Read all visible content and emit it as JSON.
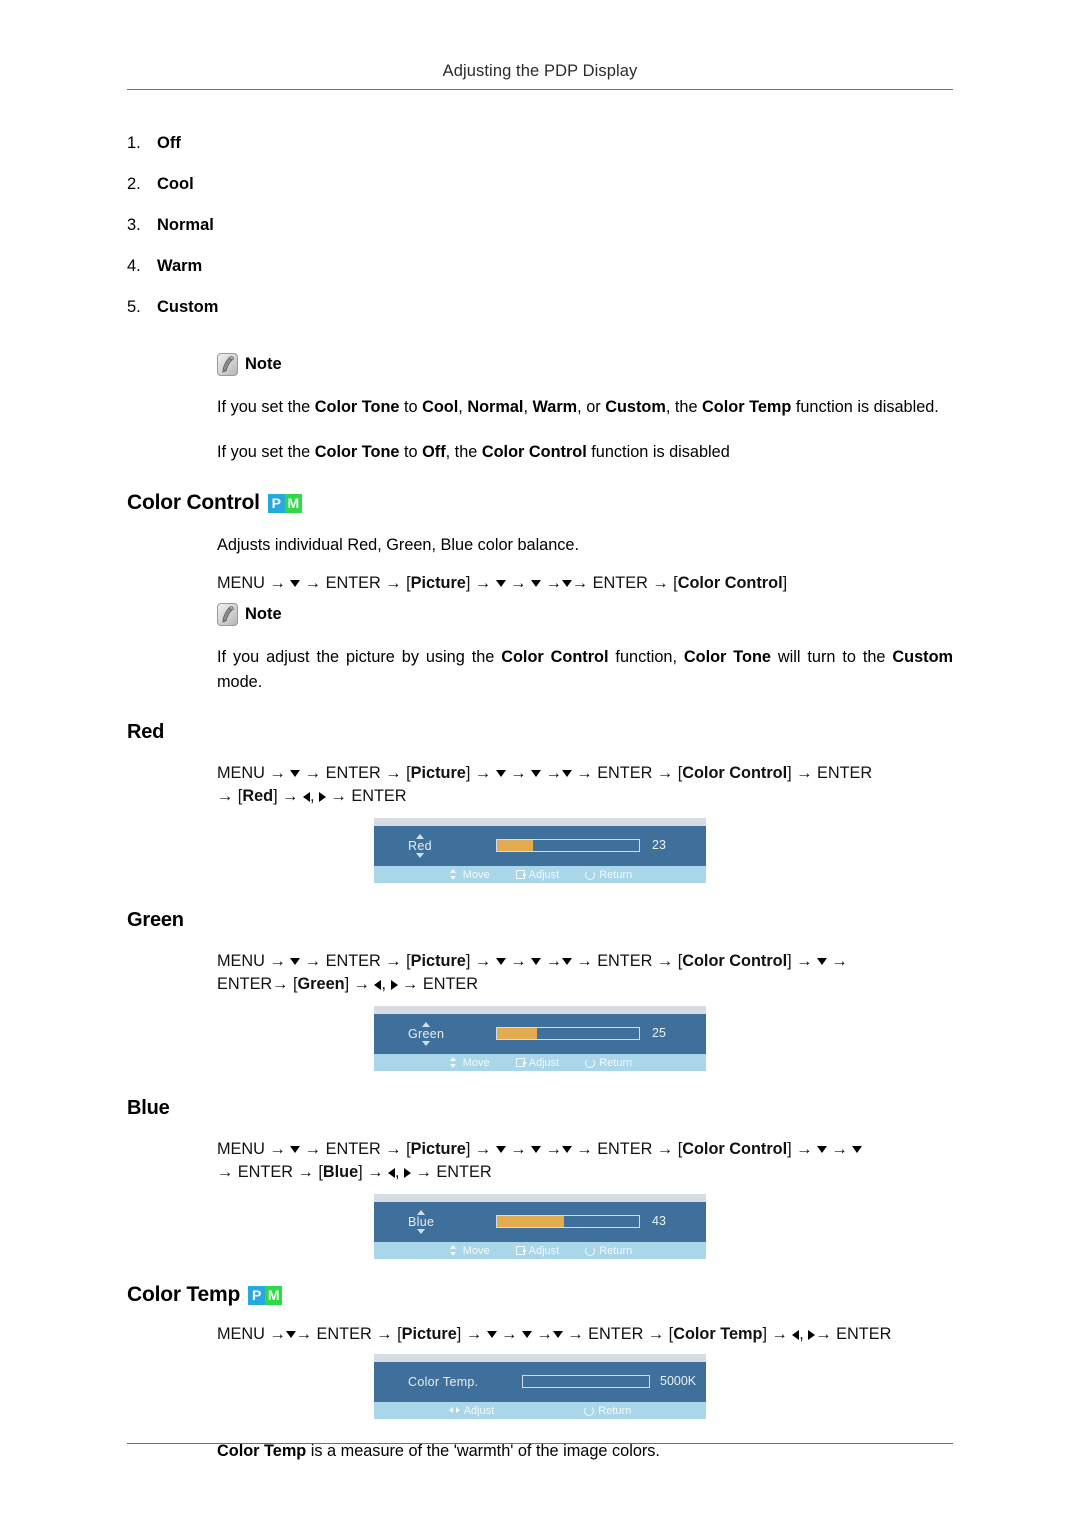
{
  "header": {
    "title": "Adjusting the PDP Display"
  },
  "color_tone_options": [
    {
      "num": "1.",
      "label": "Off"
    },
    {
      "num": "2.",
      "label": "Cool"
    },
    {
      "num": "3.",
      "label": "Normal"
    },
    {
      "num": "4.",
      "label": "Warm"
    },
    {
      "num": "5.",
      "label": "Custom"
    }
  ],
  "note_label": "Note",
  "notes_top": [
    "If you set the Color Tone to Cool, Normal, Warm, or Custom, the Color Temp function is disabled.",
    "If you set the Color Tone to Off, the Color Control function is disabled"
  ],
  "color_control": {
    "heading": "Color Control",
    "badge": {
      "p": "P",
      "m": "M",
      "p_color": "#29a8df",
      "m_color": "#2fd947"
    },
    "description": "Adjusts individual Red, Green, Blue color balance.",
    "menu_path": "MENU → ▼ → ENTER → [Picture] → ▼ → ▼ →▼→ ENTER → [Color Control]",
    "note": "If you adjust the picture by using the Color Control function, Color Tone will turn to the Custom mode."
  },
  "red": {
    "heading": "Red",
    "menu_path": "MENU → ▼ → ENTER → [Picture] → ▼ → ▼ →▼ → ENTER → [Color Control] → ENTER → [Red] → ◄, ► → ENTER",
    "osd": {
      "label": "Red",
      "value": "23",
      "fill_percent": 25,
      "footer": [
        {
          "icon": "up-down-arrow-icon",
          "label": "Move"
        },
        {
          "icon": "enter-icon",
          "label": "Adjust"
        },
        {
          "icon": "return-icon",
          "label": "Return"
        }
      ]
    }
  },
  "green": {
    "heading": "Green",
    "menu_path": "MENU → ▼ → ENTER → [Picture] → ▼ → ▼ →▼ → ENTER → [Color Control] → ▼ → ENTER→ [Green] → ◄, ► → ENTER",
    "osd": {
      "label": "Green",
      "value": "25",
      "fill_percent": 28,
      "footer": [
        {
          "icon": "up-down-arrow-icon",
          "label": "Move"
        },
        {
          "icon": "enter-icon",
          "label": "Adjust"
        },
        {
          "icon": "return-icon",
          "label": "Return"
        }
      ]
    }
  },
  "blue": {
    "heading": "Blue",
    "menu_path": "MENU → ▼ → ENTER → [Picture] → ▼ → ▼ →▼ → ENTER → [Color Control] → ▼ → ▼ → ENTER → [Blue] → ◄, ► → ENTER",
    "osd": {
      "label": "Blue",
      "value": "43",
      "fill_percent": 47,
      "footer": [
        {
          "icon": "up-down-arrow-icon",
          "label": "Move"
        },
        {
          "icon": "enter-icon",
          "label": "Adjust"
        },
        {
          "icon": "return-icon",
          "label": "Return"
        }
      ]
    }
  },
  "color_temp": {
    "heading": "Color Temp",
    "badge": {
      "p": "P",
      "m": "M"
    },
    "menu_path": "MENU →▼→ ENTER → [Picture] → ▼ → ▼ →▼ → ENTER → [Color Temp] → ◄, ► → ENTER",
    "osd": {
      "label": "Color  Temp.",
      "value": "5000K",
      "fill_percent": 0,
      "footer": [
        {
          "icon": "left-right-arrow-icon",
          "label": "Adjust"
        },
        {
          "icon": "return-icon",
          "label": "Return"
        }
      ]
    },
    "footnote": "Color Temp is a measure of the 'warmth' of the image colors."
  },
  "colors": {
    "osd_body": "#3f709b",
    "osd_footer": "#a9d6e9",
    "osd_fill": "#e3ab50",
    "osd_top_strip": "#d7dbe4"
  }
}
